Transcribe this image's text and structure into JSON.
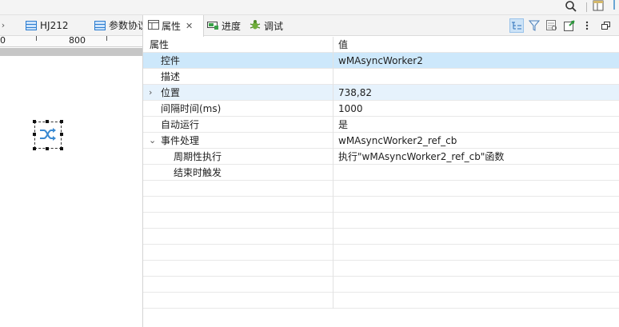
{
  "left_tabs": [
    {
      "label": "HJ212"
    },
    {
      "label": "参数协议"
    }
  ],
  "ruler": {
    "labels": [
      "0",
      "800"
    ]
  },
  "right_tabs": [
    {
      "label": "属性",
      "active": true
    },
    {
      "label": "进度"
    },
    {
      "label": "调试"
    }
  ],
  "table": {
    "header": {
      "name": "属性",
      "value": "值"
    },
    "rows": [
      {
        "name": "控件",
        "value": "wMAsyncWorker2",
        "selected": true
      },
      {
        "name": "描述",
        "value": ""
      },
      {
        "name": "位置",
        "value": "738,82",
        "expander": "collapsed",
        "highlight": true
      },
      {
        "name": "间隔时间(ms)",
        "value": "1000"
      },
      {
        "name": "自动运行",
        "value": "是"
      },
      {
        "name": "事件处理",
        "value": "wMAsyncWorker2_ref_cb",
        "expander": "expanded"
      },
      {
        "name": "周期性执行",
        "value": "执行\"wMAsyncWorker2_ref_cb\"函数",
        "child": true
      },
      {
        "name": "结束时触发",
        "value": "",
        "child": true
      }
    ]
  },
  "colors": {
    "selected_row": "#cde8fb",
    "accent": "#2a7cd0"
  }
}
